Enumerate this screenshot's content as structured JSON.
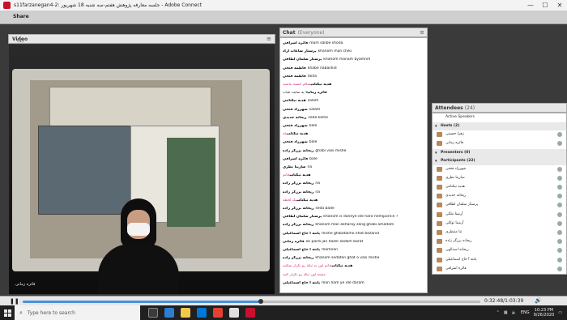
{
  "window": {
    "title": "s11farzanegan4-2: جلسه معارفه پژوهش هفتم-سه شنبه 18 شهریور - Adobe Connect",
    "controls": [
      "—",
      "☐",
      "✕"
    ]
  },
  "share": {
    "label": "Share"
  },
  "video": {
    "label": "Video",
    "count": "(1)",
    "presenter": "فائزه زمانی",
    "menu_icon": "menu-icon"
  },
  "chat": {
    "label": "Chat",
    "sub": "(Everyone)",
    "messages": [
      {
        "who": "فائزه اشرافی",
        "text": "mam salibe shoda"
      },
      {
        "who": "پرستار ساعات آزاد",
        "text": "khanom man chiki"
      },
      {
        "who": "پرستار سلمان لطافی",
        "text": "khanom manam byamnm"
      },
      {
        "who": "فاطمه فتحی",
        "text": "khabe nabashid"
      },
      {
        "who": "فاطمه فتحی",
        "text": "faida"
      },
      {
        "who": "هدیه نیکنامی",
        "text": "سلام خسته نباشید",
        "pink": true
      },
      {
        "who": "فائزه زمانی",
        "text": "لا یه سایت غیاب"
      },
      {
        "who": "هدیه نیکنامی",
        "text": "salam"
      },
      {
        "who": "شهرزاد فتحی",
        "text": "salam"
      },
      {
        "who": "ریحانه جدیدی",
        "text": "seda kame"
      },
      {
        "who": "شهرزاد فتحی",
        "text": "bale"
      },
      {
        "who": "هدیه نیکنامی",
        "text": "بله",
        "pink": true
      },
      {
        "who": "شهرزاد فتحی",
        "text": "bale"
      },
      {
        "who": "ریحانه برزگر زاده",
        "text": "ghabi vasi mishe"
      },
      {
        "who": "فائزه اشرافی",
        "text": "bale"
      },
      {
        "who": "سارینا نظری",
        "text": "na"
      },
      {
        "who": "هدیه نیکنامی",
        "text": "خانم",
        "pink": true
      },
      {
        "who": "ریحانه برزگر زاده",
        "text": "na"
      },
      {
        "who": "ریحانه برزگر زاده",
        "text": "na"
      },
      {
        "who": "هدیه نیکنامی",
        "text": "یک لحظه",
        "pink": true
      },
      {
        "who": "ریحانه برزگر زاده",
        "text": "seda bade"
      },
      {
        "who": "پرستار سلمان لطافی",
        "text": "khanom is daneye ide haro nemipornin ?"
      },
      {
        "who": "ریحانه برزگر زاده",
        "text": "khanom man akharay zang ghabi amadam"
      },
      {
        "who": "پانته آ حاج اسماعیلی",
        "text": "mishe ghibataimo khat bezanid"
      },
      {
        "who": "فائزه زمانی",
        "text": "ok pardi jan hazer zadam barat"
      },
      {
        "who": "پانته آ حاج اسماعیلی",
        "text": "mamnon"
      },
      {
        "who": "ریحانه برزگر زاده",
        "text": "khanom sedaton ghat o vasi mishe"
      },
      {
        "who": "هدیه نیکنامی",
        "text": "خانم اون یه تیکه رو تکرار میکنید",
        "pink": true
      },
      {
        "who": "",
        "text": "میشه اون تیکه رو تکرار کنید",
        "pink": true
      },
      {
        "who": "پانته آ حاج اسماعیلی",
        "text": "man ham ye ide daram"
      }
    ]
  },
  "attendees": {
    "label": "Attendees",
    "count": "(24)",
    "active_speakers": "Active Speakers",
    "hosts_label": "Hosts (2)",
    "hosts": [
      "زهرا حسینی",
      "فائزه زمانی"
    ],
    "presenters_label": "Presenters (0)",
    "participants_label": "Participants (22)",
    "participants": [
      "شهرزاد فتحی",
      "سارینا نظری",
      "هدیه نیکنامی",
      "ریحانه جدیدی",
      "پرستار سلمان لطافی",
      "آرمیتا ملکی",
      "آرمیتا توکلی",
      "ثنا منتظری",
      "ریحانه برزگر زاده",
      "ریحانه اسدالهی",
      "پانته آ حاج اسماعیلی",
      "فائزه اشرافی",
      "پانته آ حاج اسماعیلی"
    ]
  },
  "playback": {
    "time": "0:32:48/1:03:39",
    "progress": 0.52
  },
  "taskbar": {
    "search_placeholder": "Type here to search",
    "lang": "ENG",
    "time": "10:23 PM",
    "date": "9/26/2020"
  },
  "colors": {
    "accent": "#4a90d9",
    "pink_text": "#d63384",
    "taskbar": "#202020"
  }
}
